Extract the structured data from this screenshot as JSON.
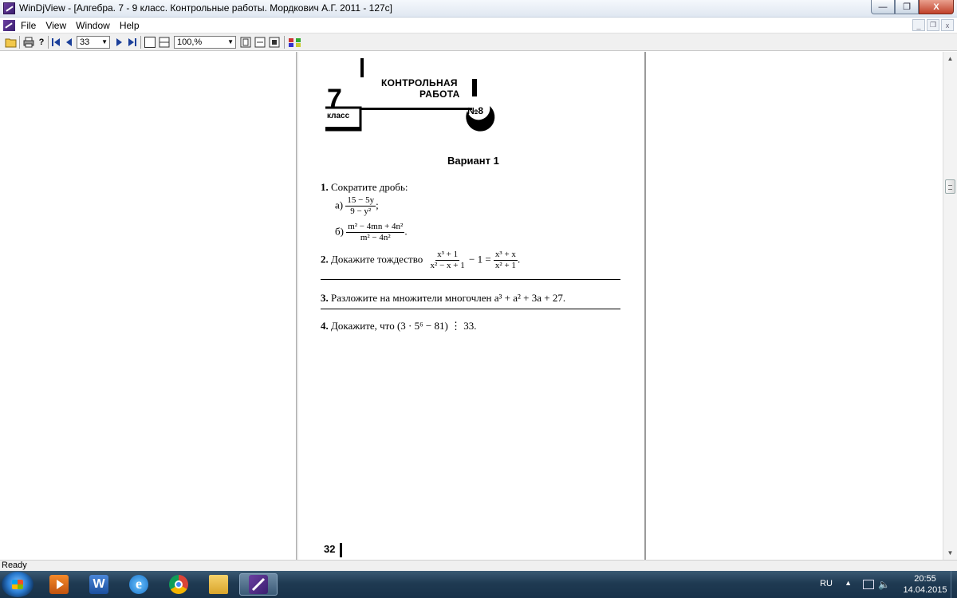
{
  "window": {
    "title": "WinDjView - [Алгебра. 7 - 9 класс. Контрольные работы. Мордкович А.Г. 2011 - 127с]",
    "minimize": "—",
    "maximize": "❐",
    "close": "X"
  },
  "menu": {
    "items": [
      "File",
      "View",
      "Window",
      "Help"
    ],
    "mdi_minimize": "_",
    "mdi_restore": "❐",
    "mdi_close": "x"
  },
  "toolbar": {
    "page_number": "33",
    "zoom": "100,%"
  },
  "status": {
    "text": "Ready"
  },
  "taskbar": {
    "apps": [
      "media-player-icon",
      "word-icon",
      "ie-icon",
      "chrome-icon",
      "explorer-icon",
      "windjview-icon"
    ],
    "tray": {
      "lang": "RU",
      "time": "20:55",
      "date": "14.04.2015"
    }
  },
  "document": {
    "banner": {
      "grade": "7",
      "grade_label": "класс",
      "title_line1": "КОНТРОЛЬНАЯ",
      "title_line2": "РАБОТА",
      "number": "№8"
    },
    "variant": "Вариант 1",
    "ex1": {
      "num": "1.",
      "text": "Сократите дробь:",
      "a_label": "а)",
      "a_num": "15 − 5y",
      "a_den": "9 − y²",
      "a_end": ";",
      "b_label": "б)",
      "b_num": "m² − 4mn + 4n²",
      "b_den": "m² − 4n²",
      "b_end": "."
    },
    "ex2": {
      "num": "2.",
      "text": "Докажите тождество",
      "l_num": "x³ + 1",
      "l_den": "x² − x + 1",
      "mid": "− 1 =",
      "r_num": "x³ + x",
      "r_den": "x² + 1",
      "end": "."
    },
    "ex3": {
      "num": "3.",
      "text": "Разложите на множители многочлен a³ + a² + 3a + 27."
    },
    "ex4": {
      "num": "4.",
      "text": "Докажите, что (3 · 5⁶ − 81) ⋮ 33."
    },
    "page_number": "32"
  }
}
